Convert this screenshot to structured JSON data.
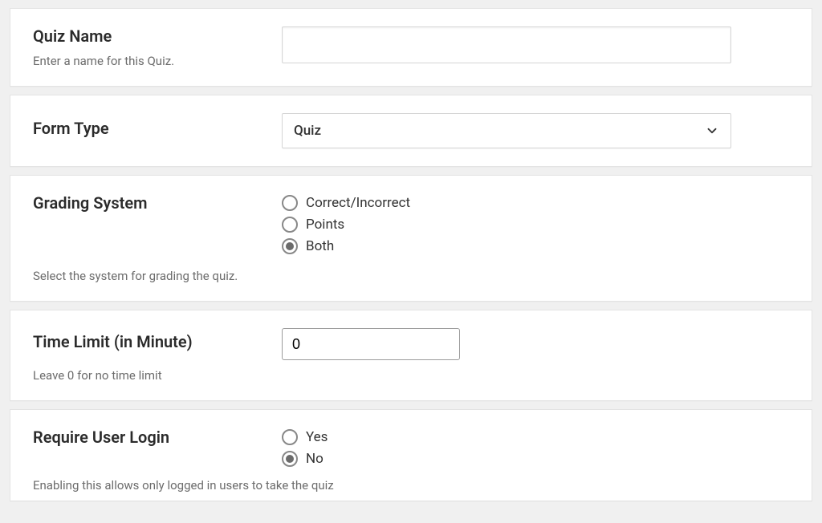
{
  "quizName": {
    "label": "Quiz Name",
    "desc": "Enter a name for this Quiz.",
    "value": ""
  },
  "formType": {
    "label": "Form Type",
    "selected": "Quiz"
  },
  "gradingSystem": {
    "label": "Grading System",
    "desc": "Select the system for grading the quiz.",
    "options": {
      "correct": "Correct/Incorrect",
      "points": "Points",
      "both": "Both"
    },
    "selected": "both"
  },
  "timeLimit": {
    "label": "Time Limit (in Minute)",
    "desc": "Leave 0 for no time limit",
    "value": "0"
  },
  "requireLogin": {
    "label": "Require User Login",
    "desc": "Enabling this allows only logged in users to take the quiz",
    "options": {
      "yes": "Yes",
      "no": "No"
    },
    "selected": "no"
  }
}
